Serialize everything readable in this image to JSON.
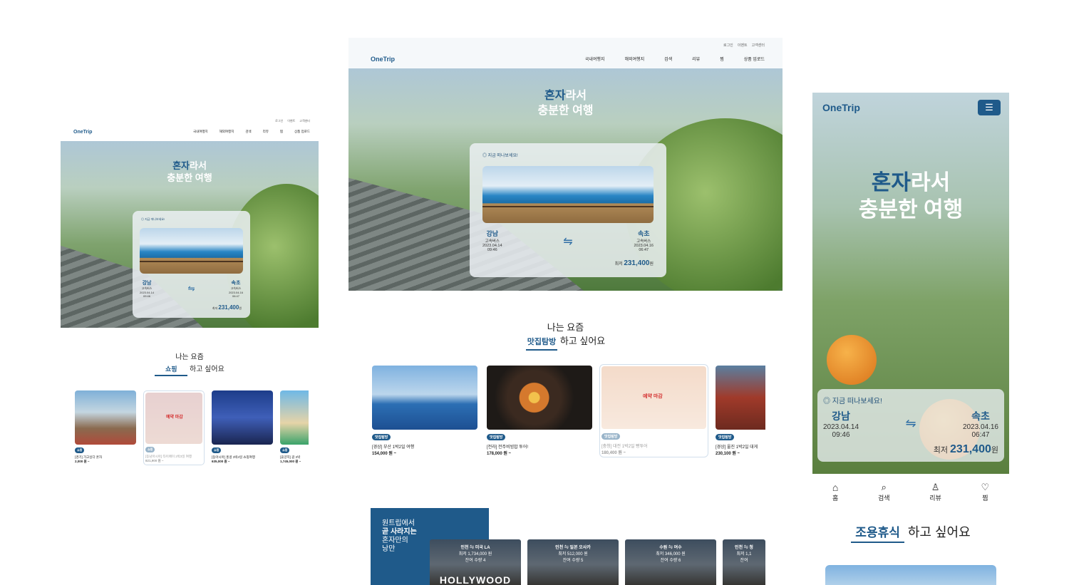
{
  "site": {
    "logo": "OneTrip",
    "top_links": [
      "로그인",
      "이벤트",
      "고객센터"
    ],
    "nav": [
      "국내여행지",
      "해외여행지",
      "검색",
      "리뷰",
      "찜",
      "상품 업로드"
    ],
    "hero_bold": "혼자",
    "hero_rest": "라서",
    "hero_line2": "충분한 여행"
  },
  "trip": {
    "badge": "지금 떠나보세요!",
    "from": "강남",
    "from_sub": "고속버스",
    "from_date": "2023.04.14",
    "from_time": "09:46",
    "swap": "⇋",
    "to": "속초",
    "to_sub": "고속버스",
    "to_date": "2023.04.16",
    "to_time": "06:47",
    "price_label": "최저",
    "price": "231,400",
    "price_unit": "원"
  },
  "intro": {
    "line1": "나는 요즘",
    "suffix": "하고 싶어요",
    "chip_small": "쇼핑",
    "chip_mid": "맛집탐방",
    "chip_mobile": "조용휴식"
  },
  "products_small": [
    {
      "tag": "쇼핑",
      "title": "[경기] 가고싶다 혼자",
      "price": "2,000 원 ~"
    },
    {
      "tag": "쇼핑",
      "title": "[동남아시아] 타이페이 2박3일 여행",
      "price": "821,900 원 ~",
      "closed": "예약 마감"
    },
    {
      "tag": "쇼핑",
      "title": "[동아시아] 홍콩 3박4일 쇼핑여행",
      "price": "635,000 원 ~"
    },
    {
      "tag": "쇼핑",
      "title": "[휴양지] 괌 3박",
      "price": "1,745,000 원 ~"
    }
  ],
  "products_mid": [
    {
      "tag": "맛집탐방",
      "title": "[경상] 부산 1박2일 여행",
      "price": "154,000 원 ~"
    },
    {
      "tag": "맛집탐방",
      "title": "[전라] 전주비빔밥 투어!",
      "price": "178,000 원 ~"
    },
    {
      "tag": "맛집탐방",
      "title": "[충청] 대전 1박2일 빵투어",
      "price": "180,400 원 ~",
      "closed": "예약 마감"
    },
    {
      "tag": "맛집탐방",
      "title": "[경상] 울진 1박2일 대게",
      "price": "230,100 원 ~"
    }
  ],
  "promo": {
    "line1": "원트립에서",
    "line2": "곧 사라지는",
    "line3": "혼자만의",
    "line4": "낭만"
  },
  "tickets": [
    {
      "route": "인천 ⇋ 미국 LA",
      "price": "최저 1,734,000 원",
      "left": "잔여 수량 4"
    },
    {
      "route": "인천 ⇋ 일본 오사카",
      "price": "최저 512,000 원",
      "left": "잔여 수량 5"
    },
    {
      "route": "수원 ⇋ 여수",
      "price": "최저 346,000 원",
      "left": "잔여 수량 6"
    },
    {
      "route": "인천 ⇋ 청",
      "price": "최저 1,1",
      "left": "잔여"
    }
  ],
  "ticket_sign": "HOLLYWOOD",
  "bottom_nav": [
    "홈",
    "검색",
    "리뷰",
    "찜"
  ],
  "colors": {
    "brand": "#1f5a8a",
    "closed": "#d43030"
  }
}
